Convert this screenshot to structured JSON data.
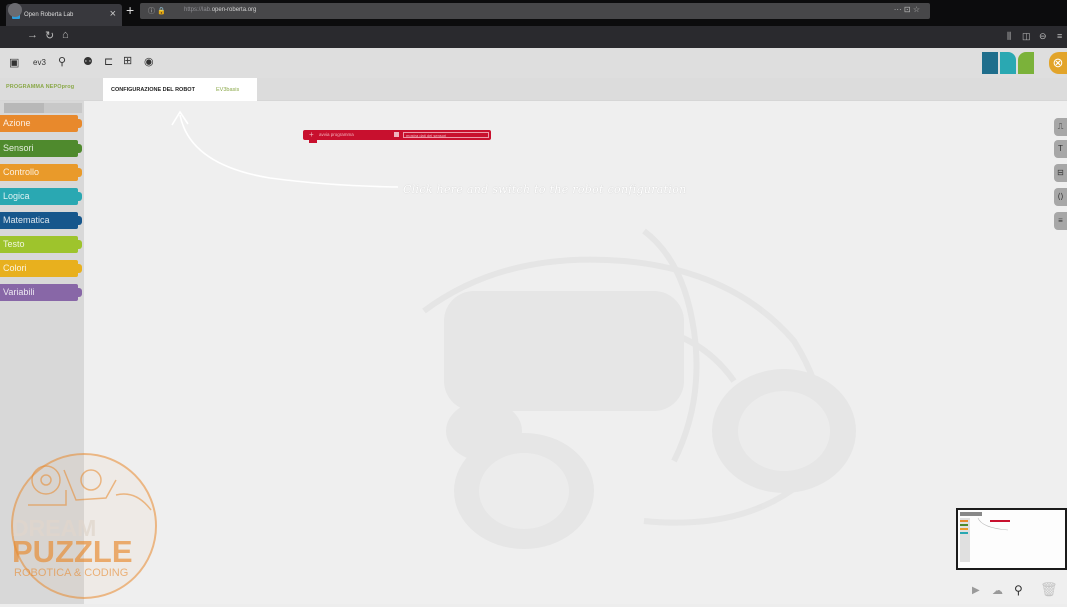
{
  "browser": {
    "tab_title": "Open Roberta Lab",
    "tab_close": "×",
    "new_tab": "+",
    "url_prefix": "https://lab.",
    "url_domain": "open-roberta.org",
    "url_right": "··· ⊡ ☆"
  },
  "app": {
    "tabs": {
      "program_label": "PROGRAMMA NEPOprog",
      "config_label": "CONFIGURAZIONE DEL ROBOT",
      "config_name": "EV3basis"
    },
    "palette_tabs": [
      "",
      ""
    ],
    "categories": [
      {
        "label": "Azione",
        "color": "#e8892c"
      },
      {
        "label": "Sensori",
        "color": "#4f8a2d"
      },
      {
        "label": "Controllo",
        "color": "#e99a2a"
      },
      {
        "label": "Logica",
        "color": "#2aa8b2"
      },
      {
        "label": "Matematica",
        "color": "#17578c"
      },
      {
        "label": "Testo",
        "color": "#9ec42c"
      },
      {
        "label": "Colori",
        "color": "#e8b01e"
      },
      {
        "label": "Variabili",
        "color": "#8867a7"
      }
    ],
    "start_block": {
      "label": "avvia programma",
      "checkbox_label": "mostra dati dei sensori",
      "color": "#c8102e"
    },
    "logo_colors": [
      "#1f6e8c",
      "#2aa8b2",
      "#7bb23a"
    ]
  },
  "annotation": {
    "text": "Click here and switch to the robot configuration"
  },
  "watermark": {
    "line1": "DREAM",
    "line2": "PUZZLE",
    "line3": "ROBOTICA & CODING",
    "color": "#e8892c"
  }
}
